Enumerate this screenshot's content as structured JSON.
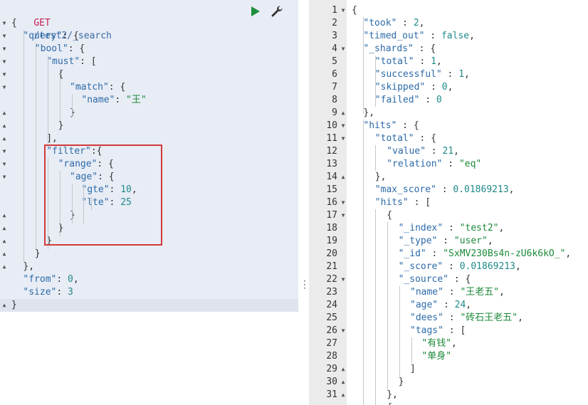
{
  "request": {
    "method": "GET",
    "path": "/test2/_search",
    "lines": [
      [
        [
          "p",
          "{"
        ]
      ],
      [
        [
          "k",
          "\"query\""
        ],
        [
          "p",
          ": {"
        ]
      ],
      [
        [
          "k",
          "\"bool\""
        ],
        [
          "p",
          ": {"
        ]
      ],
      [
        [
          "k",
          "\"must\""
        ],
        [
          "p",
          ": ["
        ]
      ],
      [
        [
          "p",
          "{"
        ]
      ],
      [
        [
          "k",
          "\"match\""
        ],
        [
          "p",
          ": {"
        ]
      ],
      [
        [
          "k",
          "\"name\""
        ],
        [
          "p",
          ": "
        ],
        [
          "s",
          "\"王\""
        ]
      ],
      [
        [
          "p",
          "}"
        ]
      ],
      [
        [
          "p",
          "}"
        ]
      ],
      [
        [
          "p",
          "],"
        ]
      ],
      [
        [
          "k",
          "\"filter\""
        ],
        [
          "p",
          ":{"
        ]
      ],
      [
        [
          "k",
          "\"range\""
        ],
        [
          "p",
          ": {"
        ]
      ],
      [
        [
          "k",
          "\"age\""
        ],
        [
          "p",
          ": {"
        ]
      ],
      [
        [
          "k",
          "\"gte\""
        ],
        [
          "p",
          ": "
        ],
        [
          "n",
          "10"
        ],
        [
          "p",
          ","
        ]
      ],
      [
        [
          "k",
          "\"lte\""
        ],
        [
          "p",
          ": "
        ],
        [
          "n",
          "25"
        ]
      ],
      [
        [
          "p",
          "}"
        ]
      ],
      [
        [
          "p",
          "}"
        ]
      ],
      [
        [
          "p",
          "}"
        ]
      ],
      [
        [
          "p",
          "}"
        ]
      ],
      [
        [
          "p",
          "},"
        ]
      ],
      [
        [
          "k",
          "\"from\""
        ],
        [
          "p",
          ": "
        ],
        [
          "n",
          "0"
        ],
        [
          "p",
          ","
        ]
      ],
      [
        [
          "k",
          "\"size\""
        ],
        [
          "p",
          ": "
        ],
        [
          "n",
          "3"
        ]
      ],
      [
        [
          "p",
          "}"
        ]
      ]
    ]
  },
  "response": {
    "lines": [
      [
        [
          "p",
          "{"
        ]
      ],
      [
        [
          "k",
          "\"took\""
        ],
        [
          "p",
          " : "
        ],
        [
          "n",
          "2"
        ],
        [
          "p",
          ","
        ]
      ],
      [
        [
          "k",
          "\"timed_out\""
        ],
        [
          "p",
          " : "
        ],
        [
          "b",
          "false"
        ],
        [
          "p",
          ","
        ]
      ],
      [
        [
          "k",
          "\"_shards\""
        ],
        [
          "p",
          " : {"
        ]
      ],
      [
        [
          "k",
          "\"total\""
        ],
        [
          "p",
          " : "
        ],
        [
          "n",
          "1"
        ],
        [
          "p",
          ","
        ]
      ],
      [
        [
          "k",
          "\"successful\""
        ],
        [
          "p",
          " : "
        ],
        [
          "n",
          "1"
        ],
        [
          "p",
          ","
        ]
      ],
      [
        [
          "k",
          "\"skipped\""
        ],
        [
          "p",
          " : "
        ],
        [
          "n",
          "0"
        ],
        [
          "p",
          ","
        ]
      ],
      [
        [
          "k",
          "\"failed\""
        ],
        [
          "p",
          " : "
        ],
        [
          "n",
          "0"
        ]
      ],
      [
        [
          "p",
          "},"
        ]
      ],
      [
        [
          "k",
          "\"hits\""
        ],
        [
          "p",
          " : {"
        ]
      ],
      [
        [
          "k",
          "\"total\""
        ],
        [
          "p",
          " : {"
        ]
      ],
      [
        [
          "k",
          "\"value\""
        ],
        [
          "p",
          " : "
        ],
        [
          "n",
          "21"
        ],
        [
          "p",
          ","
        ]
      ],
      [
        [
          "k",
          "\"relation\""
        ],
        [
          "p",
          " : "
        ],
        [
          "s",
          "\"eq\""
        ]
      ],
      [
        [
          "p",
          "},"
        ]
      ],
      [
        [
          "k",
          "\"max_score\""
        ],
        [
          "p",
          " : "
        ],
        [
          "n",
          "0.01869213"
        ],
        [
          "p",
          ","
        ]
      ],
      [
        [
          "k",
          "\"hits\""
        ],
        [
          "p",
          " : ["
        ]
      ],
      [
        [
          "p",
          "{"
        ]
      ],
      [
        [
          "k",
          "\"_index\""
        ],
        [
          "p",
          " : "
        ],
        [
          "s",
          "\"test2\""
        ],
        [
          "p",
          ","
        ]
      ],
      [
        [
          "k",
          "\"_type\""
        ],
        [
          "p",
          " : "
        ],
        [
          "s",
          "\"user\""
        ],
        [
          "p",
          ","
        ]
      ],
      [
        [
          "k",
          "\"_id\""
        ],
        [
          "p",
          " : "
        ],
        [
          "s",
          "\"SxMV230Bs4n-zU6k6kO_\""
        ],
        [
          "p",
          ","
        ]
      ],
      [
        [
          "k",
          "\"_score\""
        ],
        [
          "p",
          " : "
        ],
        [
          "n",
          "0.01869213"
        ],
        [
          "p",
          ","
        ]
      ],
      [
        [
          "k",
          "\"_source\""
        ],
        [
          "p",
          " : {"
        ]
      ],
      [
        [
          "k",
          "\"name\""
        ],
        [
          "p",
          " : "
        ],
        [
          "s",
          "\"王老五\""
        ],
        [
          "p",
          ","
        ]
      ],
      [
        [
          "k",
          "\"age\""
        ],
        [
          "p",
          " : "
        ],
        [
          "n",
          "24"
        ],
        [
          "p",
          ","
        ]
      ],
      [
        [
          "k",
          "\"dees\""
        ],
        [
          "p",
          " : "
        ],
        [
          "s",
          "\"砖石王老五\""
        ],
        [
          "p",
          ","
        ]
      ],
      [
        [
          "k",
          "\"tags\""
        ],
        [
          "p",
          " : ["
        ]
      ],
      [
        [
          "s",
          "\"有钱\""
        ],
        [
          "p",
          ","
        ]
      ],
      [
        [
          "s",
          "\"单身\""
        ]
      ],
      [
        [
          "p",
          "]"
        ]
      ],
      [
        [
          "p",
          "}"
        ]
      ],
      [
        [
          "p",
          "},"
        ]
      ],
      [
        [
          "p",
          "{"
        ]
      ]
    ],
    "line_numbers": [
      "1",
      "2",
      "3",
      "4",
      "5",
      "6",
      "7",
      "8",
      "9",
      "10",
      "11",
      "12",
      "13",
      "14",
      "15",
      "16",
      "17",
      "18",
      "19",
      "20",
      "21",
      "22",
      "23",
      "24",
      "25",
      "26",
      "27",
      "28",
      "29",
      "30",
      "31",
      ""
    ]
  },
  "icons": {
    "play": "play-icon",
    "wrench": "wrench-icon",
    "drag": "drag-handle-icon"
  },
  "colors": {
    "highlight_border": "#d23a3a",
    "play_green": "#1e8e3e"
  }
}
